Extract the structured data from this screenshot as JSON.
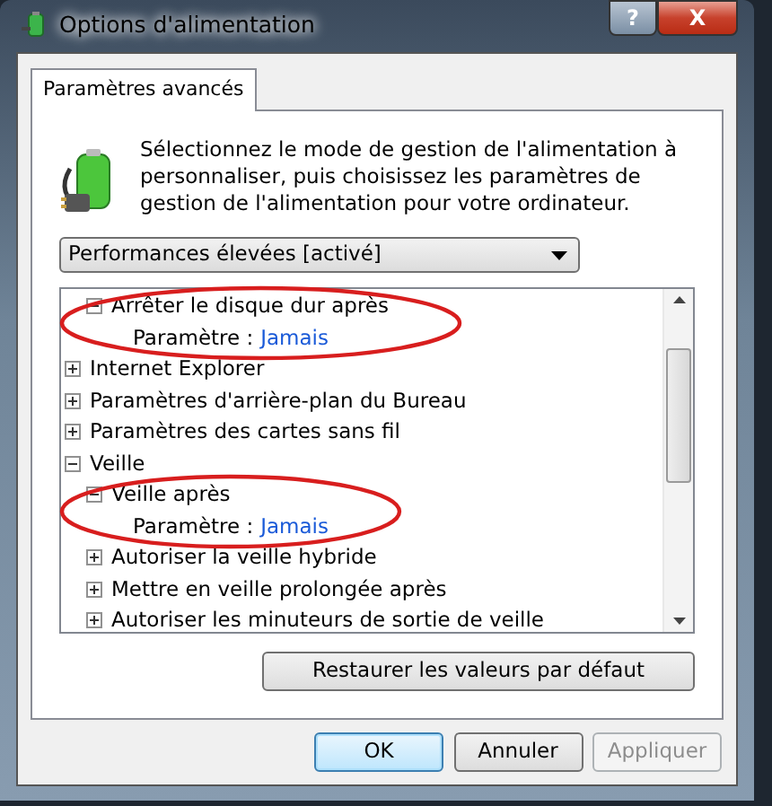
{
  "window": {
    "title": "Options d'alimentation",
    "buttons": [
      {
        "kind": "help",
        "label": "?"
      },
      {
        "kind": "close",
        "label": "X"
      }
    ]
  },
  "tabs": [
    {
      "label": "Paramètres avancés",
      "selected": true
    }
  ],
  "intro": "Sélectionnez le mode de gestion de l'alimentation à personnaliser, puis choisissez les paramètres de gestion de l'alimentation pour votre ordinateur.",
  "plan_select": {
    "value": "Performances élevées [activé]"
  },
  "tree": [
    {
      "children": [
        {
          "label": "Arrêter le disque dur après",
          "expanded": true,
          "circled": true,
          "children": [
            {
              "kind": "setting",
              "label": "Paramètre :",
              "value": "Jamais"
            }
          ]
        }
      ]
    },
    {
      "label": "Internet Explorer",
      "expanded": false
    },
    {
      "label": "Paramètres d'arrière-plan du Bureau",
      "expanded": false
    },
    {
      "label": "Paramètres des cartes sans fil",
      "expanded": false
    },
    {
      "label": "Veille",
      "expanded": true,
      "children": [
        {
          "label": "Veille après",
          "expanded": true,
          "circled": true,
          "children": [
            {
              "kind": "setting",
              "label": "Paramètre :",
              "value": "Jamais"
            }
          ]
        },
        {
          "label": "Autoriser la veille hybride",
          "expanded": false
        },
        {
          "label": "Mettre en veille prolongée après",
          "expanded": false
        },
        {
          "label": "Autoriser les minuteurs de sortie de veille",
          "expanded": false
        }
      ]
    }
  ],
  "restore_button": {
    "label": "Restaurer les valeurs par défaut"
  },
  "buttons": [
    {
      "label": "OK",
      "default": true,
      "disabled": false
    },
    {
      "label": "Annuler",
      "default": false,
      "disabled": false
    },
    {
      "label": "Appliquer",
      "default": false,
      "disabled": true
    }
  ]
}
